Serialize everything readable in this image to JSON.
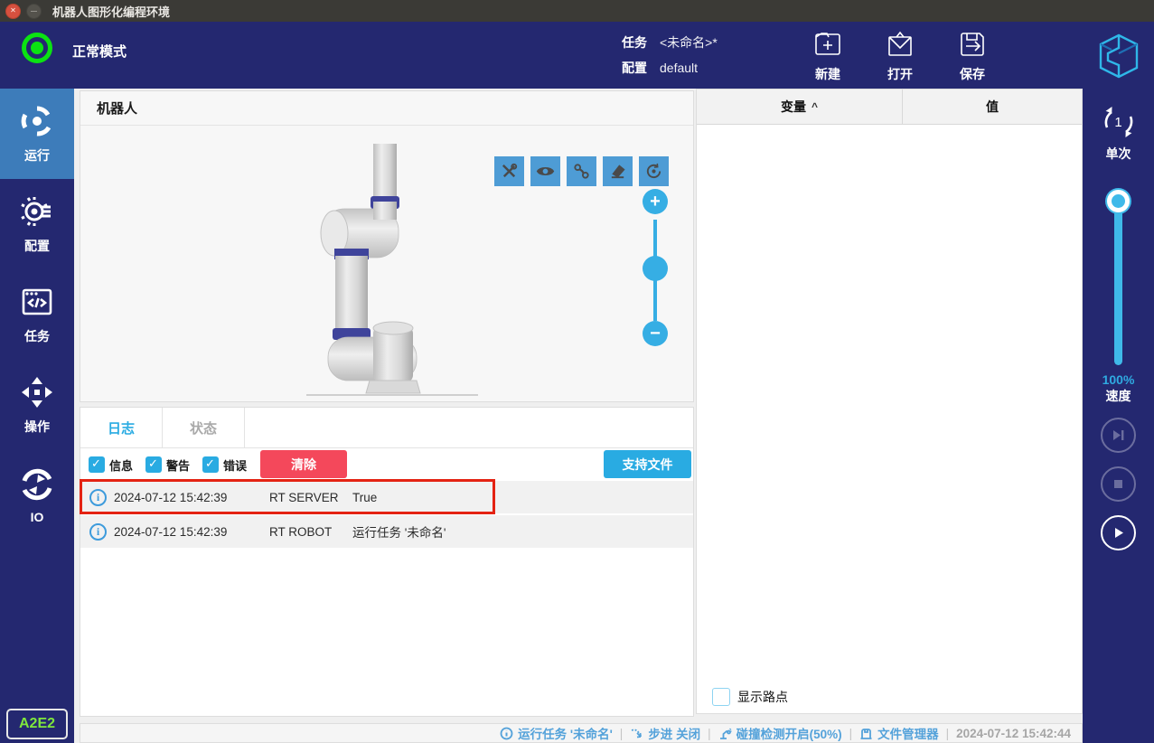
{
  "window": {
    "title": "机器人图形化编程环境"
  },
  "header": {
    "mode": "正常模式",
    "task_label": "任务",
    "task_value": "<未命名>*",
    "config_label": "配置",
    "config_value": "default",
    "buttons": {
      "new": "新建",
      "open": "打开",
      "save": "保存"
    }
  },
  "sidebar": {
    "items": [
      {
        "label": "运行",
        "icon": "run-icon",
        "active": true
      },
      {
        "label": "配置",
        "icon": "settings-icon",
        "active": false
      },
      {
        "label": "任务",
        "icon": "task-icon",
        "active": false
      },
      {
        "label": "操作",
        "icon": "operate-icon",
        "active": false
      },
      {
        "label": "IO",
        "icon": "io-icon",
        "active": false
      }
    ],
    "badge": "A2E2"
  },
  "robot_panel": {
    "title": "机器人"
  },
  "log_panel": {
    "tabs": [
      {
        "label": "日志",
        "active": true
      },
      {
        "label": "状态",
        "active": false
      }
    ],
    "filters": [
      {
        "label": "信息",
        "checked": true
      },
      {
        "label": "警告",
        "checked": true
      },
      {
        "label": "错误",
        "checked": true
      }
    ],
    "clear_button": "清除",
    "support_button": "支持文件",
    "rows": [
      {
        "time": "2024-07-12 15:42:39",
        "source": "RT SERVER",
        "message": "True",
        "highlighted": true
      },
      {
        "time": "2024-07-12 15:42:39",
        "source": "RT ROBOT",
        "message": "运行任务 '未命名'",
        "highlighted": false
      }
    ]
  },
  "variables_panel": {
    "columns": [
      "变量",
      "值"
    ],
    "sort_indicator": "^",
    "show_waypoints_label": "显示路点",
    "show_waypoints_checked": false
  },
  "run_controls": {
    "loop_count": "1",
    "loop_label": "单次",
    "speed_percent": "100%",
    "speed_label": "速度"
  },
  "status_bar": {
    "items": [
      {
        "label": "运行任务 '未命名'",
        "icon": "info-icon"
      },
      {
        "label": "步进 关闭",
        "icon": "step-icon"
      },
      {
        "label": "碰撞检测开启(50%)",
        "icon": "collision-icon"
      },
      {
        "label": "文件管理器",
        "icon": "file-manager-icon"
      }
    ],
    "separator": "|",
    "timestamp": "2024-07-12 15:42:44"
  },
  "colors": {
    "navy": "#242870",
    "accent_cyan": "#29ABE2",
    "active_nav_blue": "#3D7CBA",
    "clear_red": "#F4485B",
    "annotation_red": "#E42313",
    "mode_green": "#0BE312",
    "badge_green": "#7FE73C"
  }
}
